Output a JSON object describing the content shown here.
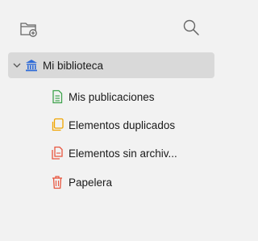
{
  "toolbar": {
    "new_collection_icon": "new-collection-icon",
    "search_icon": "search-icon"
  },
  "library": {
    "label": "Mi biblioteca",
    "expanded": true,
    "items": [
      {
        "label": "Mis publicaciones",
        "icon": "publications-icon",
        "color": "#3fa34d"
      },
      {
        "label": "Elementos duplicados",
        "icon": "duplicate-icon",
        "color": "#f0a500"
      },
      {
        "label": "Elementos sin archiv...",
        "icon": "unfiled-icon",
        "color": "#e8553e"
      },
      {
        "label": "Papelera",
        "icon": "trash-icon",
        "color": "#e8553e"
      }
    ]
  },
  "colors": {
    "accent": "#2e6bd8",
    "background": "#f2f2f2",
    "selected_row": "#d9d9d9"
  }
}
